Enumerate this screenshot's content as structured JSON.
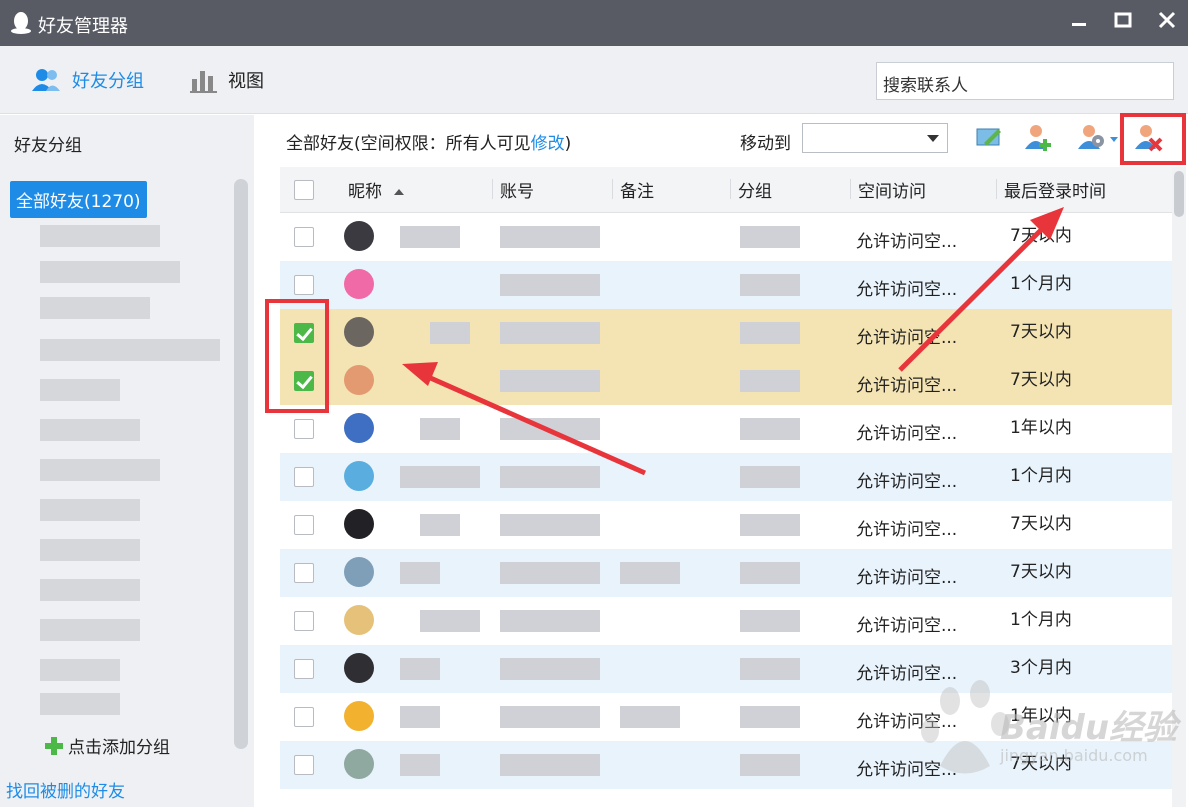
{
  "window": {
    "title": "好友管理器"
  },
  "toolbar": {
    "group_label": "好友分组",
    "view_label": "视图",
    "search_placeholder": "搜索联系人"
  },
  "sidebar": {
    "heading": "好友分组",
    "all_friends": "全部好友(1270)",
    "add_group": "点击添加分组",
    "recover": "找回被删的好友"
  },
  "main": {
    "crumb_prefix": "全部好友(空间权限：所有人可见",
    "crumb_link": "修改",
    "crumb_suffix": ")",
    "move_to": "移动到"
  },
  "table": {
    "columns": [
      "昵称",
      "账号",
      "备注",
      "分组",
      "空间访问",
      "最后登录时间"
    ],
    "rows": [
      {
        "checked": false,
        "space": "允许访问空...",
        "login": "7天以内",
        "avatar": "#3a3a40"
      },
      {
        "checked": false,
        "space": "允许访问空...",
        "login": "1个月内",
        "avatar": "#f06aa8"
      },
      {
        "checked": true,
        "space": "允许访问空...",
        "login": "7天以内",
        "avatar": "#6b6660"
      },
      {
        "checked": true,
        "space": "允许访问空...",
        "login": "7天以内",
        "avatar": "#e39a70"
      },
      {
        "checked": false,
        "space": "允许访问空...",
        "login": "1年以内",
        "avatar": "#3f6fc2"
      },
      {
        "checked": false,
        "space": "允许访问空...",
        "login": "1个月内",
        "avatar": "#5aaedf"
      },
      {
        "checked": false,
        "space": "允许访问空...",
        "login": "7天以内",
        "avatar": "#222226"
      },
      {
        "checked": false,
        "space": "允许访问空...",
        "login": "7天以内",
        "avatar": "#7f9fb8"
      },
      {
        "checked": false,
        "space": "允许访问空...",
        "login": "1个月内",
        "avatar": "#e6c17a"
      },
      {
        "checked": false,
        "space": "允许访问空...",
        "login": "3个月内",
        "avatar": "#2f2f33"
      },
      {
        "checked": false,
        "space": "允许访问空...",
        "login": "1年以内",
        "avatar": "#f2b12f"
      },
      {
        "checked": false,
        "space": "允许访问空...",
        "login": "7天以内",
        "avatar": "#8fa9a0"
      }
    ]
  },
  "watermark": {
    "brand": "Baidu经验",
    "url": "jingyan.baidu.com"
  },
  "colors": {
    "accent": "#1e8ce6",
    "annotation": "#e8353b",
    "selected_row": "#f4e4b3",
    "check": "#4cb848"
  }
}
